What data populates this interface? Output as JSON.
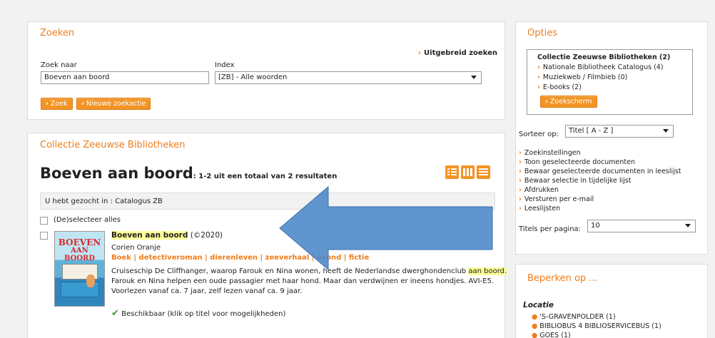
{
  "search": {
    "title": "Zoeken",
    "advanced": "Uitgebreid zoeken",
    "query_label": "Zoek naar",
    "query_value": "Boeven aan boord",
    "index_label": "Index",
    "index_value": "[ZB] - Alle woorden",
    "search_btn": "Zoek",
    "new_search_btn": "Nieuwe zoekactie"
  },
  "results": {
    "collection_title": "Collectie Zeeuwse Bibliotheken",
    "heading": "Boeven aan boord",
    "summary": ": 1-2 uit een totaal van 2 resultaten",
    "searched_in": "U hebt gezocht in : Catalogus ZB",
    "select_all": "(De)selecteer alles",
    "items": [
      {
        "cover_line1": "BOEVEN",
        "cover_line2": "AAN BOORD",
        "title": "Boeven aan boord",
        "year": "(©2020)",
        "author": "Corien Oranje",
        "tags": "Boek | detectiveroman | dierenleven | zeeverhaal | avond | fictie",
        "desc_1a": "Cruiseschip De Cliffhanger, waarop Farouk en Nina wonen, heeft de Nederlandse dwerghondenclub ",
        "desc_1b": "aan boord.",
        "desc_2": "Farouk en Nina helpen een oude passagier met haar hond. Maar dan verdwijnen er ineens hondjes. AVI-E5.",
        "desc_3": "Voorlezen vanaf ca. 7 jaar, zelf lezen vanaf ca. 9 jaar.",
        "availability": "Beschikbaar (klik op titel voor mogelijkheden)"
      }
    ]
  },
  "options": {
    "title": "Opties",
    "collection": "Collectie Zeeuwse Bibliotheken (2)",
    "sources": [
      "Nationale Bibliotheek Catalogus (4)",
      "Muziekweb / Filmbieb (0)",
      "E-books (2)"
    ],
    "search_screen_btn": "Zoekscherm",
    "sort_label": "Sorteer op:",
    "sort_value": "Titel [ A - Z ]",
    "links": [
      "Zoekinstellingen",
      "Toon geselecteerde documenten",
      "Bewaar geselecteerde documenten in leeslijst",
      "Bewaar selectie in tijdelijke lijst",
      "Afdrukken",
      "Versturen per e-mail",
      "Leeslijsten"
    ],
    "per_page_label": "Titels per pagina:",
    "per_page_value": "10"
  },
  "limit": {
    "title": "Beperken op ...",
    "location_label": "Locatie",
    "locations": [
      "'S-GRAVENPOLDER (1)",
      "BIBLIOBUS 4 BIBLIOSERVICEBUS (1)",
      "GOES (1)"
    ]
  }
}
